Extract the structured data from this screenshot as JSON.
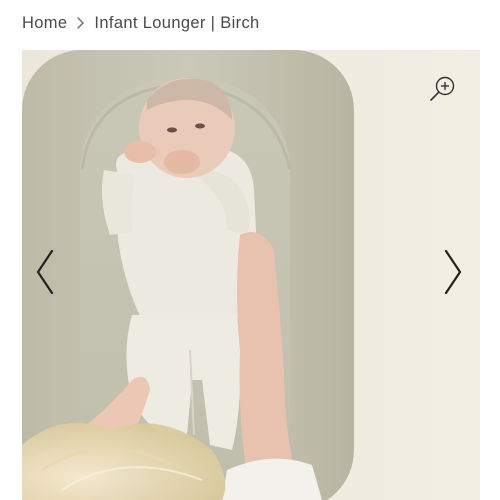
{
  "breadcrumb": {
    "home_label": "Home",
    "separator_icon": "chevron-right-icon",
    "current_label": "Infant Lounger | Birch"
  },
  "gallery": {
    "zoom_icon": "zoom-in-icon",
    "prev_icon": "chevron-left-icon",
    "next_icon": "chevron-right-icon"
  },
  "colors": {
    "text": "#4a4a4a",
    "lounger": "#c6c4b2",
    "background": "#f0ebde",
    "arrow": "#222222"
  }
}
